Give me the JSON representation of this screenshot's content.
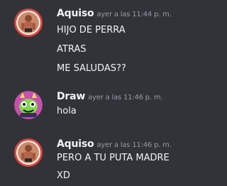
{
  "messages": [
    {
      "username": "Aquiso",
      "timestamp": "ayer a las 11:44 p. m.",
      "avatar": "aquiso-avatar-photo",
      "lines": [
        "HIJO DE PERRA",
        "ATRAS",
        "ME SALUDAS??"
      ]
    },
    {
      "username": "Draw",
      "timestamp": "ayer a las 11:46 p. m.",
      "avatar": "draw-avatar-cartoon-monster",
      "lines": [
        "hola"
      ]
    },
    {
      "username": "Aquiso",
      "timestamp": "ayer a las 11:46 p. m.",
      "avatar": "aquiso-avatar-photo",
      "lines": [
        "PERO A TU PUTA MADRE",
        "XD"
      ]
    }
  ],
  "colors": {
    "background": "#313338",
    "text": "#f2f3f5",
    "muted": "#949ba4",
    "avatar_ring": "#e8453c"
  }
}
